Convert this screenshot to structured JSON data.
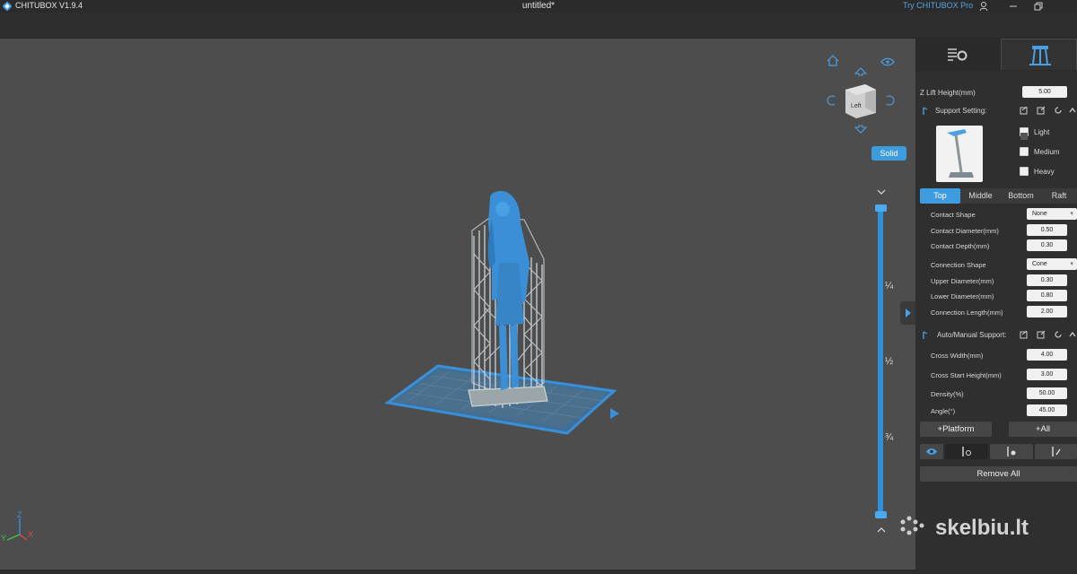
{
  "titlebar": {
    "app_name": "CHITUBOX V1.9.4",
    "document": "untitled*",
    "try_pro": "Try CHITUBOX Pro",
    "user_icon": "user-icon",
    "minimize_icon": "minimize-icon",
    "restore_icon": "restore-icon"
  },
  "viewport": {
    "view_mode": "Solid",
    "nav_cube_face": "Left",
    "slider_labels": [
      "¼",
      "½",
      "¾"
    ],
    "axis_labels": {
      "z": "Z",
      "y": "Y",
      "x": "X"
    }
  },
  "panel": {
    "z_lift_label": "Z Lift Height(mm)",
    "z_lift_value": "5.00",
    "support_setting_label": "Support Setting:",
    "density_options": [
      {
        "label": "Light",
        "checked": true
      },
      {
        "label": "Medium",
        "checked": false
      },
      {
        "label": "Heavy",
        "checked": false
      }
    ],
    "tabs": [
      "Top",
      "Middle",
      "Bottom",
      "Raft"
    ],
    "active_tab": "Top",
    "contact": {
      "shape_label": "Contact Shape",
      "shape_value": "None",
      "diameter_label": "Contact Diameter(mm)",
      "diameter_value": "0.50",
      "depth_label": "Contact Depth(mm)",
      "depth_value": "0.30"
    },
    "connection": {
      "shape_label": "Connection Shape",
      "shape_value": "Cone",
      "upper_label": "Upper Diameter(mm)",
      "upper_value": "0.30",
      "lower_label": "Lower Diameter(mm)",
      "lower_value": "0.80",
      "length_label": "Connection Length(mm)",
      "length_value": "2.00"
    },
    "auto_manual_label": "Auto/Manual Support:",
    "cross": {
      "width_label": "Cross Width(mm)",
      "width_value": "4.00",
      "start_label": "Cross Start Height(mm)",
      "start_value": "3.00",
      "density_label": "Density(%)",
      "density_value": "50.00",
      "angle_label": "Angle(°)",
      "angle_value": "45.00"
    },
    "platform_button": "+Platform",
    "all_button": "+All",
    "remove_all_button": "Remove All"
  },
  "watermark": "skelbiu.lt",
  "colors": {
    "accent": "#3d9be0",
    "model": "#3b8fd6",
    "panel": "#2f2f2f",
    "viewport": "#4d4d4d"
  }
}
